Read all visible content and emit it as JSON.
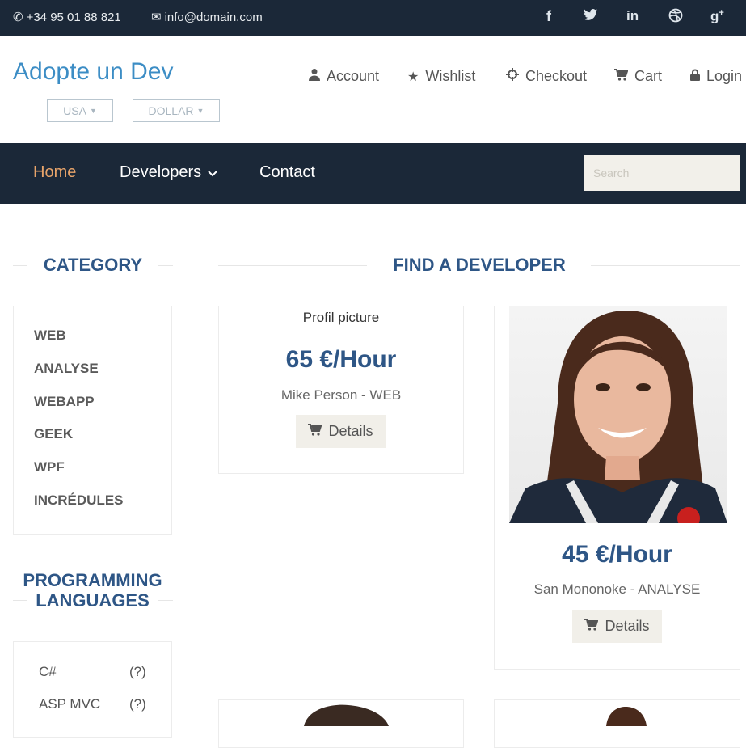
{
  "topbar": {
    "phone": "+34 95 01 88 821",
    "email": "info@domain.com",
    "socials": [
      "facebook-icon",
      "twitter-icon",
      "linkedin-icon",
      "dribbble-icon",
      "google-plus-icon"
    ]
  },
  "brand": "Adopte un Dev",
  "selects": {
    "country": "USA",
    "currency": "DOLLAR"
  },
  "usermenu": {
    "account": "Account",
    "wishlist": "Wishlist",
    "checkout": "Checkout",
    "cart": "Cart",
    "login": "Login"
  },
  "nav": {
    "home": "Home",
    "developers": "Developers",
    "contact": "Contact"
  },
  "search": {
    "placeholder": "Search"
  },
  "sidebar": {
    "category_title": "CATEGORY",
    "categories": [
      "WEB",
      "ANALYSE",
      "WEBAPP",
      "GEEK",
      "WPF",
      "INCRÉDULES"
    ],
    "languages_title_1": "PROGRAMMING",
    "languages_title_2": "LANGUAGES",
    "languages": [
      {
        "name": "C#",
        "count": "(?)"
      },
      {
        "name": "ASP MVC",
        "count": "(?)"
      }
    ]
  },
  "main": {
    "title": "FIND A DEVELOPER",
    "cards": [
      {
        "image_caption": "Profil picture",
        "price": "65 €/Hour",
        "name": "Mike Person - WEB",
        "details": "Details"
      },
      {
        "price": "45 €/Hour",
        "name": "San Mononoke - ANALYSE",
        "details": "Details"
      }
    ]
  },
  "colors": {
    "dark": "#1b2838",
    "accent": "#e8a46a",
    "title": "#2e5686",
    "brand": "#3c8dc5"
  }
}
